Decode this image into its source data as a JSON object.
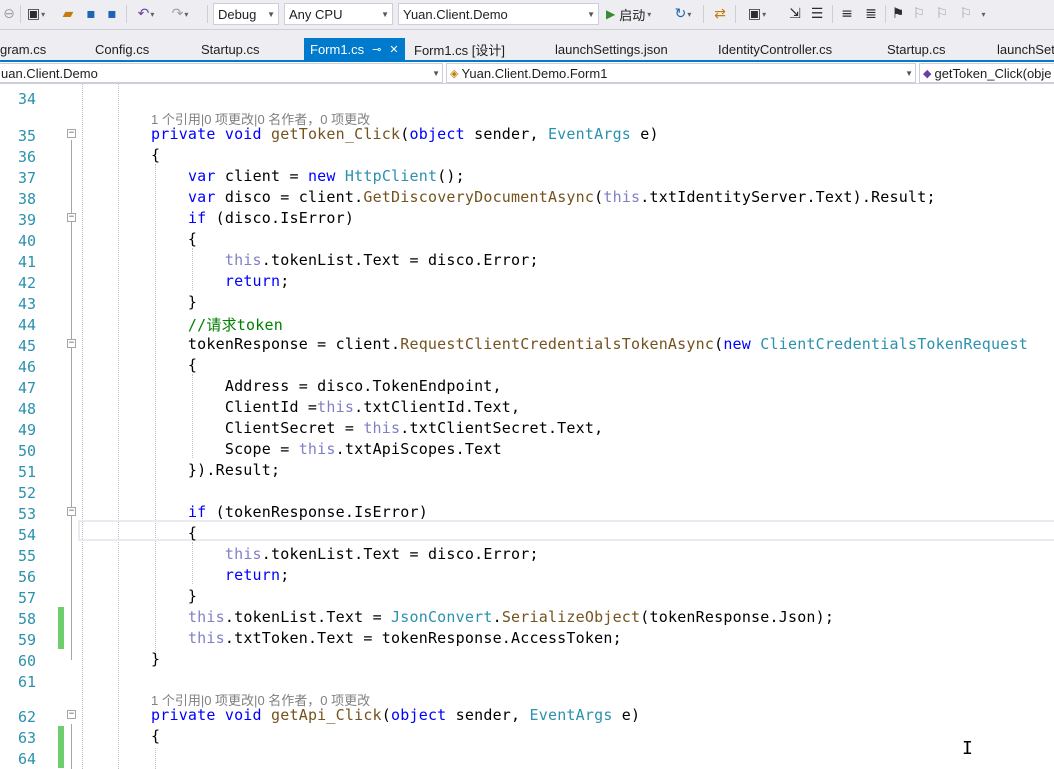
{
  "toolbar": {
    "configuration": "Debug",
    "platform": "Any CPU",
    "startup_project": "Yuan.Client.Demo",
    "start_label": "启动"
  },
  "tabs": [
    {
      "label": "gram.cs",
      "active": false
    },
    {
      "label": "Config.cs",
      "active": false
    },
    {
      "label": "Startup.cs",
      "active": false
    },
    {
      "label": "Form1.cs",
      "active": true
    },
    {
      "label": "Form1.cs [设计]",
      "active": false
    },
    {
      "label": "launchSettings.json",
      "active": false
    },
    {
      "label": "IdentityController.cs",
      "active": false
    },
    {
      "label": "Startup.cs",
      "active": false
    },
    {
      "label": "launchSett",
      "active": false
    }
  ],
  "navbar": {
    "project": "uan.Client.Demo",
    "type": "Yuan.Client.Demo.Form1",
    "member": "getToken_Click(obje"
  },
  "code_lens": {
    "getToken": "1 个引用|0 项更改|0 名作者，0 项更改",
    "getApi": "1 个引用|0 项更改|0 名作者，0 项更改"
  },
  "lines": [
    {
      "n": "34",
      "text": ""
    },
    {
      "n": "35",
      "text": "private void getToken_Click(object sender, EventArgs e)"
    },
    {
      "n": "36",
      "text": "{"
    },
    {
      "n": "37",
      "text": "    var client = new HttpClient();"
    },
    {
      "n": "38",
      "text": "    var disco = client.GetDiscoveryDocumentAsync(this.txtIdentityServer.Text).Result;"
    },
    {
      "n": "39",
      "text": "    if (disco.IsError)"
    },
    {
      "n": "40",
      "text": "    {"
    },
    {
      "n": "41",
      "text": "        this.tokenList.Text = disco.Error;"
    },
    {
      "n": "42",
      "text": "        return;"
    },
    {
      "n": "43",
      "text": "    }"
    },
    {
      "n": "44",
      "text": "    //请求token"
    },
    {
      "n": "45",
      "text": "    tokenResponse = client.RequestClientCredentialsTokenAsync(new ClientCredentialsTokenRequest"
    },
    {
      "n": "46",
      "text": "    {"
    },
    {
      "n": "47",
      "text": "        Address = disco.TokenEndpoint,"
    },
    {
      "n": "48",
      "text": "        ClientId =this.txtClientId.Text,"
    },
    {
      "n": "49",
      "text": "        ClientSecret = this.txtClientSecret.Text,"
    },
    {
      "n": "50",
      "text": "        Scope = this.txtApiScopes.Text"
    },
    {
      "n": "51",
      "text": "    }).Result;"
    },
    {
      "n": "52",
      "text": ""
    },
    {
      "n": "53",
      "text": "    if (tokenResponse.IsError)"
    },
    {
      "n": "54",
      "text": "    {"
    },
    {
      "n": "55",
      "text": "        this.tokenList.Text = disco.Error;"
    },
    {
      "n": "56",
      "text": "        return;"
    },
    {
      "n": "57",
      "text": "    }"
    },
    {
      "n": "58",
      "text": "    this.tokenList.Text = JsonConvert.SerializeObject(tokenResponse.Json);"
    },
    {
      "n": "59",
      "text": "    this.txtToken.Text = tokenResponse.AccessToken;"
    },
    {
      "n": "60",
      "text": "}"
    },
    {
      "n": "61",
      "text": ""
    },
    {
      "n": "62",
      "text": "private void getApi_Click(object sender, EventArgs e)"
    },
    {
      "n": "63",
      "text": "{"
    },
    {
      "n": "64",
      "text": ""
    }
  ],
  "colors": {
    "accent": "#007acc",
    "keyword": "#0000ff",
    "type": "#2b91af",
    "comment": "#008000",
    "change_bar": "#6ece6e"
  }
}
